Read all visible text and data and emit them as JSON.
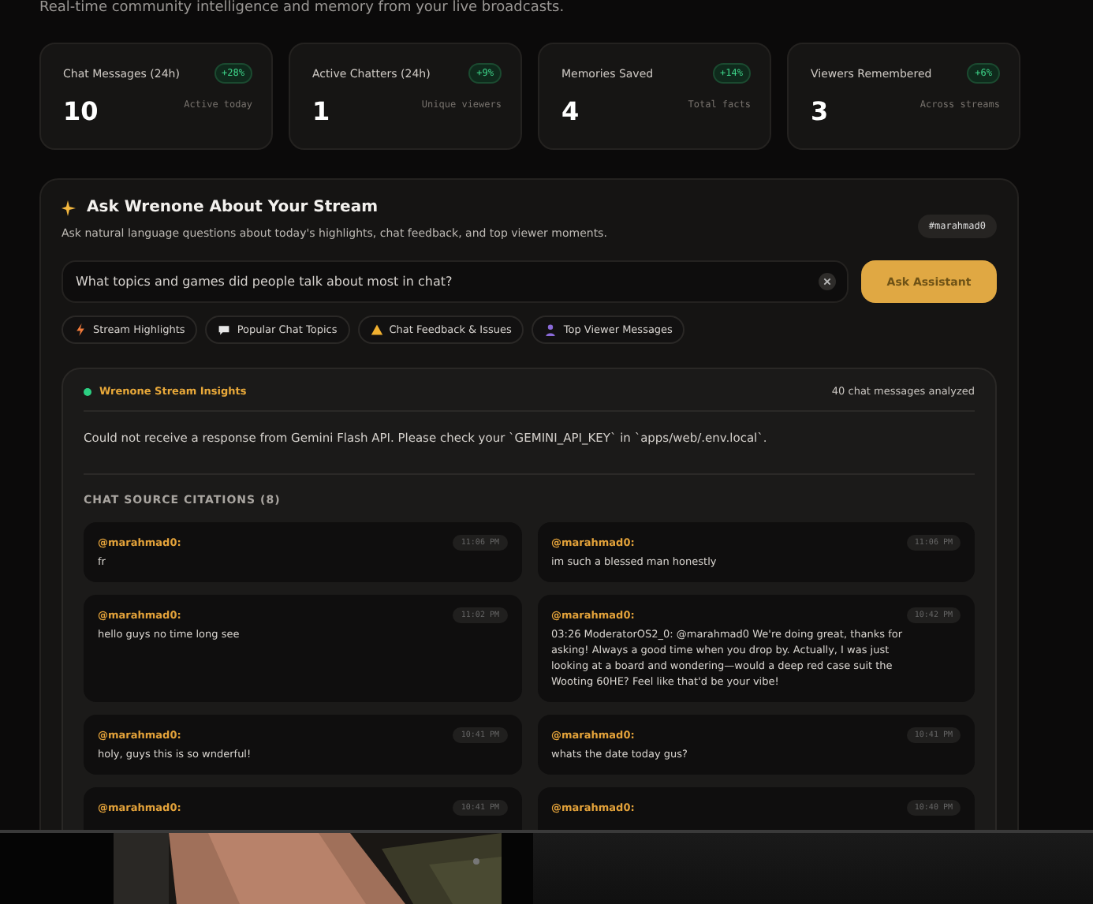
{
  "subtitle": "Real-time community intelligence and memory from your live broadcasts.",
  "stats": [
    {
      "label": "Chat Messages (24h)",
      "change": "+28%",
      "value": "10",
      "note": "Active today"
    },
    {
      "label": "Active Chatters (24h)",
      "change": "+9%",
      "value": "1",
      "note": "Unique viewers"
    },
    {
      "label": "Memories Saved",
      "change": "+14%",
      "value": "4",
      "note": "Total facts"
    },
    {
      "label": "Viewers Remembered",
      "change": "+6%",
      "value": "3",
      "note": "Across streams"
    }
  ],
  "assistant": {
    "title": "Ask Wrenone About Your Stream",
    "description": "Ask natural language questions about today's highlights, chat feedback, and top viewer moments.",
    "channel": "#marahmad0",
    "query": "What topics and games did people talk about most in chat?",
    "ask_button": {
      "label": "Ask Assistant",
      "disabled": true
    },
    "suggestions": [
      {
        "label": "Stream Highlights",
        "kind": "bolt"
      },
      {
        "label": "Popular Chat Topics",
        "kind": "bubble"
      },
      {
        "label": "Chat Feedback & Issues",
        "kind": "warning"
      },
      {
        "label": "Top Viewer Messages",
        "kind": "person"
      }
    ]
  },
  "insights": {
    "title": "Wrenone Stream Insights",
    "analyzed": "40 chat messages analyzed",
    "message": "Could not receive a response from Gemini Flash API. Please check your `GEMINI_API_KEY` in `apps/web/.env.local`.",
    "citations_heading": "CHAT SOURCE CITATIONS (8)",
    "citations": [
      {
        "user": "@marahmad0:",
        "time": "11:06 PM",
        "text": "fr"
      },
      {
        "user": "@marahmad0:",
        "time": "11:06 PM",
        "text": "im such a blessed man honestly"
      },
      {
        "user": "@marahmad0:",
        "time": "11:02 PM",
        "text": "hello guys no time long see"
      },
      {
        "user": "@marahmad0:",
        "time": "10:42 PM",
        "text": "03:26 ModeratorOS2_0: @marahmad0 We're doing great, thanks for asking! Always a good time when you drop by. Actually, I was just looking at a board and wondering—would a deep red case suit the Wooting 60HE? Feel like that'd be your vibe!"
      },
      {
        "user": "@marahmad0:",
        "time": "10:41 PM",
        "text": "holy, guys this is so wnderful!"
      },
      {
        "user": "@marahmad0:",
        "time": "10:41 PM",
        "text": "whats the date today gus?"
      },
      {
        "user": "@marahmad0:",
        "time": "10:41 PM"
      },
      {
        "user": "@marahmad0:",
        "time": "10:40 PM"
      }
    ]
  }
}
